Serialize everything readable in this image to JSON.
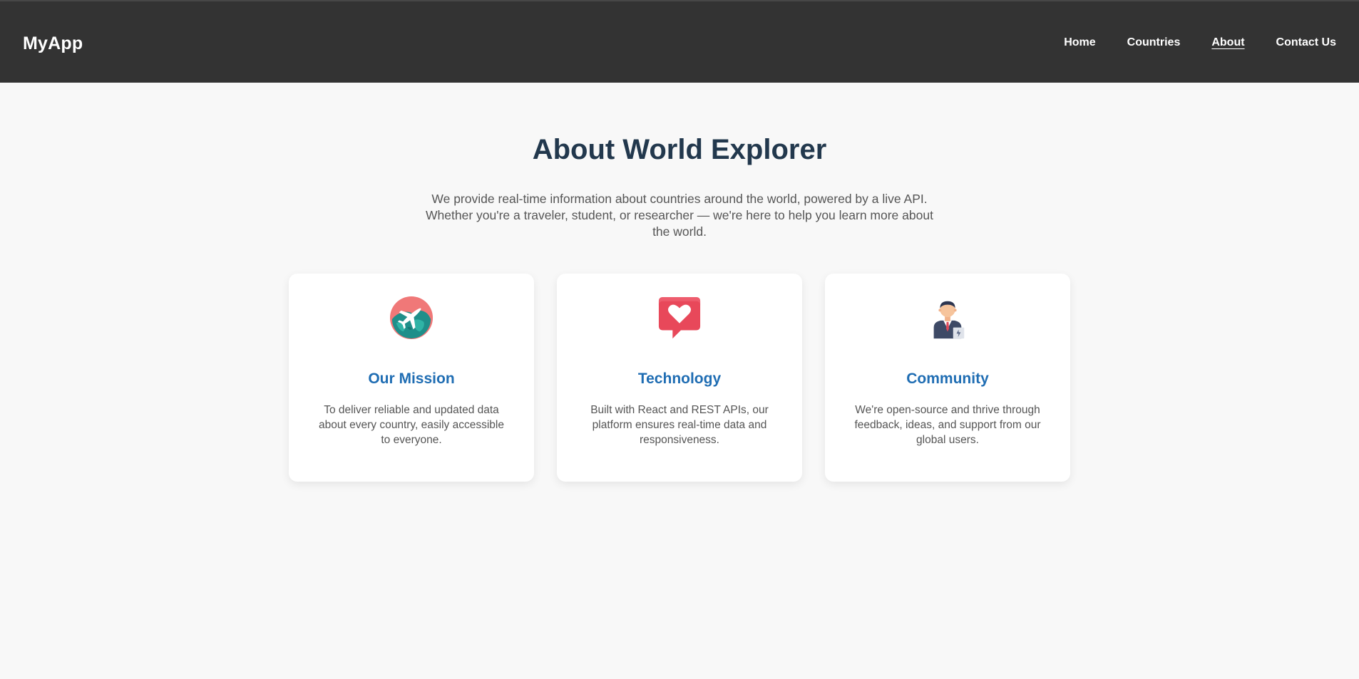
{
  "header": {
    "brand": "MyApp",
    "nav": [
      {
        "label": "Home"
      },
      {
        "label": "Countries"
      },
      {
        "label": "About",
        "active": true
      },
      {
        "label": "Contact Us"
      }
    ]
  },
  "main": {
    "title": "About World Explorer",
    "intro": "We provide real-time information about countries around the world, powered by a live API. Whether you're a traveler, student, or researcher — we're here to help you learn more about the world.",
    "cards": [
      {
        "icon": "globe-airplane-icon",
        "title": "Our Mission",
        "text": "To deliver reliable and updated data about every country, easily accessible to everyone."
      },
      {
        "icon": "heart-chat-bubble-icon",
        "title": "Technology",
        "text": "Built with React and REST APIs, our platform ensures real-time data and responsiveness."
      },
      {
        "icon": "businessman-icon",
        "title": "Community",
        "text": "We're open-source and thrive through feedback, ideas, and support from our global users."
      }
    ]
  },
  "colors": {
    "header_bg": "#333333",
    "page_bg": "#f8f8f8",
    "title": "#22384d",
    "card_title": "#1f6db3",
    "body_text": "#555555"
  }
}
